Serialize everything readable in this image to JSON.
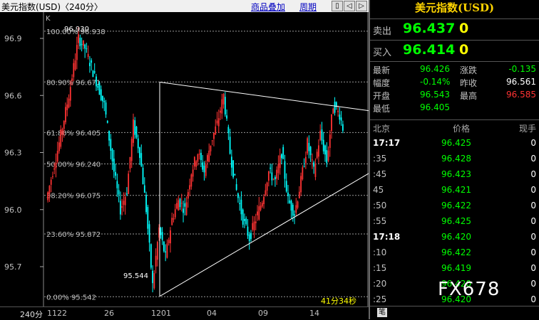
{
  "header": {
    "title": "美元指数(USD)〈240分〉",
    "overlay_link": "商品叠加",
    "period_link": "周期",
    "nav_prev": "◁",
    "nav_next": "▷",
    "nav_expand": "▯"
  },
  "chart": {
    "k_label": "K",
    "y_ticks": [
      "96.9",
      "96.6",
      "96.3",
      "96.0",
      "95.7"
    ],
    "high_label": "96.930",
    "low_label": "95.544",
    "fib_labels": [
      "100.00% 96.938",
      "80.90% 96.671",
      "61.80% 96.405",
      "50.00% 96.240",
      "38.20% 96.075",
      "23.60% 95.872",
      "0.00% 95.542"
    ],
    "countdown": "41分34秒",
    "colors": {
      "up": "#ff3333",
      "down": "#00ffff",
      "fib": "#aaaaaa",
      "trend": "#ffffff"
    }
  },
  "chart_data": {
    "type": "candlestick",
    "title": "美元指数(USD)",
    "ylim": [
      95.5,
      97.0
    ],
    "fib_levels": [
      96.938,
      96.671,
      96.405,
      96.24,
      96.075,
      95.872,
      95.542
    ],
    "high": 96.93,
    "low": 95.544
  },
  "xaxis": {
    "period": "240分",
    "dates": [
      "1122",
      "26",
      "1201",
      "04",
      "09",
      "14"
    ]
  },
  "panel": {
    "title": "美元指数(USD)",
    "sell_label": "卖出",
    "sell_value": "96.437",
    "sell_vol": "0",
    "buy_label": "买入",
    "buy_value": "96.414",
    "buy_vol": "0",
    "stats": [
      {
        "l1": "最新",
        "v1": "96.426",
        "l2": "涨跌",
        "v2": "-0.135"
      },
      {
        "l1": "幅度",
        "v1": "-0.14%",
        "l2": "昨收",
        "v2": "96.561"
      },
      {
        "l1": "开盘",
        "v1": "96.543",
        "l2": "最高",
        "v2": "96.585"
      },
      {
        "l1": "最低",
        "v1": "96.405",
        "l2": "",
        "v2": ""
      }
    ],
    "ticks_header": {
      "time": "北京",
      "price": "价格",
      "vol": "现手"
    },
    "ticks": [
      {
        "time": "17:17",
        "price": "96.425",
        "vol": "0",
        "bold": true
      },
      {
        "time": ":35",
        "price": "96.428",
        "vol": "0"
      },
      {
        "time": ":45",
        "price": "96.423",
        "vol": "0"
      },
      {
        "time": "45",
        "price": "96.421",
        "vol": "0"
      },
      {
        "time": ":50",
        "price": "96.422",
        "vol": "0"
      },
      {
        "time": ":55",
        "price": "96.425",
        "vol": "0"
      },
      {
        "time": "17:18",
        "price": "96.420",
        "vol": "0",
        "bold": true
      },
      {
        "time": ":10",
        "price": "96.422",
        "vol": "0"
      },
      {
        "time": ":15",
        "price": "96.419",
        "vol": "0"
      },
      {
        "time": ":20",
        "price": "96.420",
        "vol": "0"
      },
      {
        "time": ":25",
        "price": "96.420",
        "vol": "0"
      }
    ],
    "pen": "笔",
    "watermark": "FX678"
  }
}
